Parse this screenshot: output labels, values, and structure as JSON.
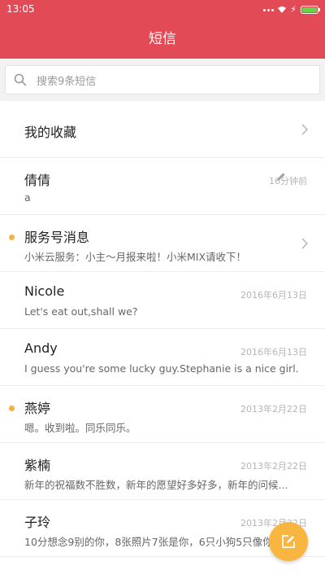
{
  "status_bar": {
    "time": "13:05"
  },
  "app_bar": {
    "title": "短信"
  },
  "search": {
    "placeholder": "搜索9条短信"
  },
  "favorites": {
    "label": "我的收藏"
  },
  "conversations": [
    {
      "name": "倩倩",
      "preview": "a",
      "time": "16分钟前",
      "draft": true,
      "unread": false,
      "has_chevron": false
    },
    {
      "name": "服务号消息",
      "preview": "小米云服务：小主～月报来啦！小米MIX请收下！",
      "time": "",
      "draft": false,
      "unread": true,
      "has_chevron": true
    },
    {
      "name": "Nicole",
      "preview": "Let's eat out,shall we?",
      "time": "2016年6月13日",
      "draft": false,
      "unread": false,
      "has_chevron": false
    },
    {
      "name": "Andy",
      "preview": "I guess you're some lucky guy.Stephanie is a nice girl.",
      "time": "2016年6月13日",
      "draft": false,
      "unread": false,
      "has_chevron": false
    },
    {
      "name": "燕婷",
      "preview": "嗯。收到啦。同乐同乐。",
      "time": "2013年2月22日",
      "draft": false,
      "unread": true,
      "has_chevron": false
    },
    {
      "name": "紫楠",
      "preview": "新年的祝福数不胜数，新年的愿望好多好多，新年的问候...",
      "time": "2013年2月22日",
      "draft": false,
      "unread": false,
      "has_chevron": false
    },
    {
      "name": "子玲",
      "preview": "10分想念9别的你，8张照片7张是你，6只小狗5只像你",
      "time": "2013年2月22日",
      "draft": false,
      "unread": false,
      "has_chevron": false
    }
  ],
  "colors": {
    "accent": "#e24a55",
    "unread_dot": "#f5b041",
    "fab": "#f8b640"
  },
  "icons": {
    "search": "search-icon",
    "chevron": "chevron-right-icon",
    "draft": "pencil-icon",
    "compose": "compose-icon"
  }
}
